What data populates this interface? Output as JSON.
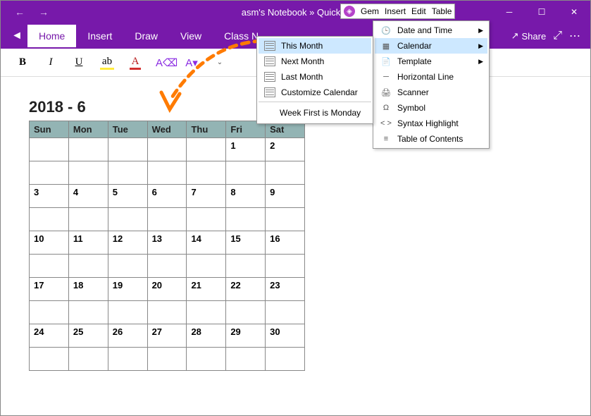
{
  "titlebar": {
    "title": "asm's Notebook » Quick N"
  },
  "gembar": {
    "items": [
      "Gem",
      "Insert",
      "Edit",
      "Table"
    ]
  },
  "tabs": [
    "Home",
    "Insert",
    "Draw",
    "View",
    "Class N"
  ],
  "share_label": "Share",
  "calendar": {
    "title": "2018 - 6",
    "days": [
      "Sun",
      "Mon",
      "Tue",
      "Wed",
      "Thu",
      "Fri",
      "Sat"
    ],
    "rows": [
      [
        "",
        "",
        "",
        "",
        "",
        "1",
        "2"
      ],
      [
        "",
        "",
        "",
        "",
        "",
        "",
        ""
      ],
      [
        "3",
        "4",
        "5",
        "6",
        "7",
        "8",
        "9"
      ],
      [
        "",
        "",
        "",
        "",
        "",
        "",
        ""
      ],
      [
        "10",
        "11",
        "12",
        "13",
        "14",
        "15",
        "16"
      ],
      [
        "",
        "",
        "",
        "",
        "",
        "",
        ""
      ],
      [
        "17",
        "18",
        "19",
        "20",
        "21",
        "22",
        "23"
      ],
      [
        "",
        "",
        "",
        "",
        "",
        "",
        ""
      ],
      [
        "24",
        "25",
        "26",
        "27",
        "28",
        "29",
        "30"
      ],
      [
        "",
        "",
        "",
        "",
        "",
        "",
        ""
      ]
    ]
  },
  "menu1": {
    "items": [
      "This Month",
      "Next Month",
      "Last Month",
      "Customize Calendar"
    ],
    "footer": "Week First is Monday"
  },
  "menu2": {
    "items": [
      {
        "label": "Date and Time",
        "arrow": true
      },
      {
        "label": "Calendar",
        "arrow": true,
        "hl": true
      },
      {
        "label": "Template",
        "arrow": true
      },
      {
        "label": "Horizontal Line"
      },
      {
        "label": "Scanner"
      },
      {
        "label": "Symbol"
      },
      {
        "label": "Syntax Highlight"
      },
      {
        "label": "Table of Contents"
      }
    ]
  }
}
